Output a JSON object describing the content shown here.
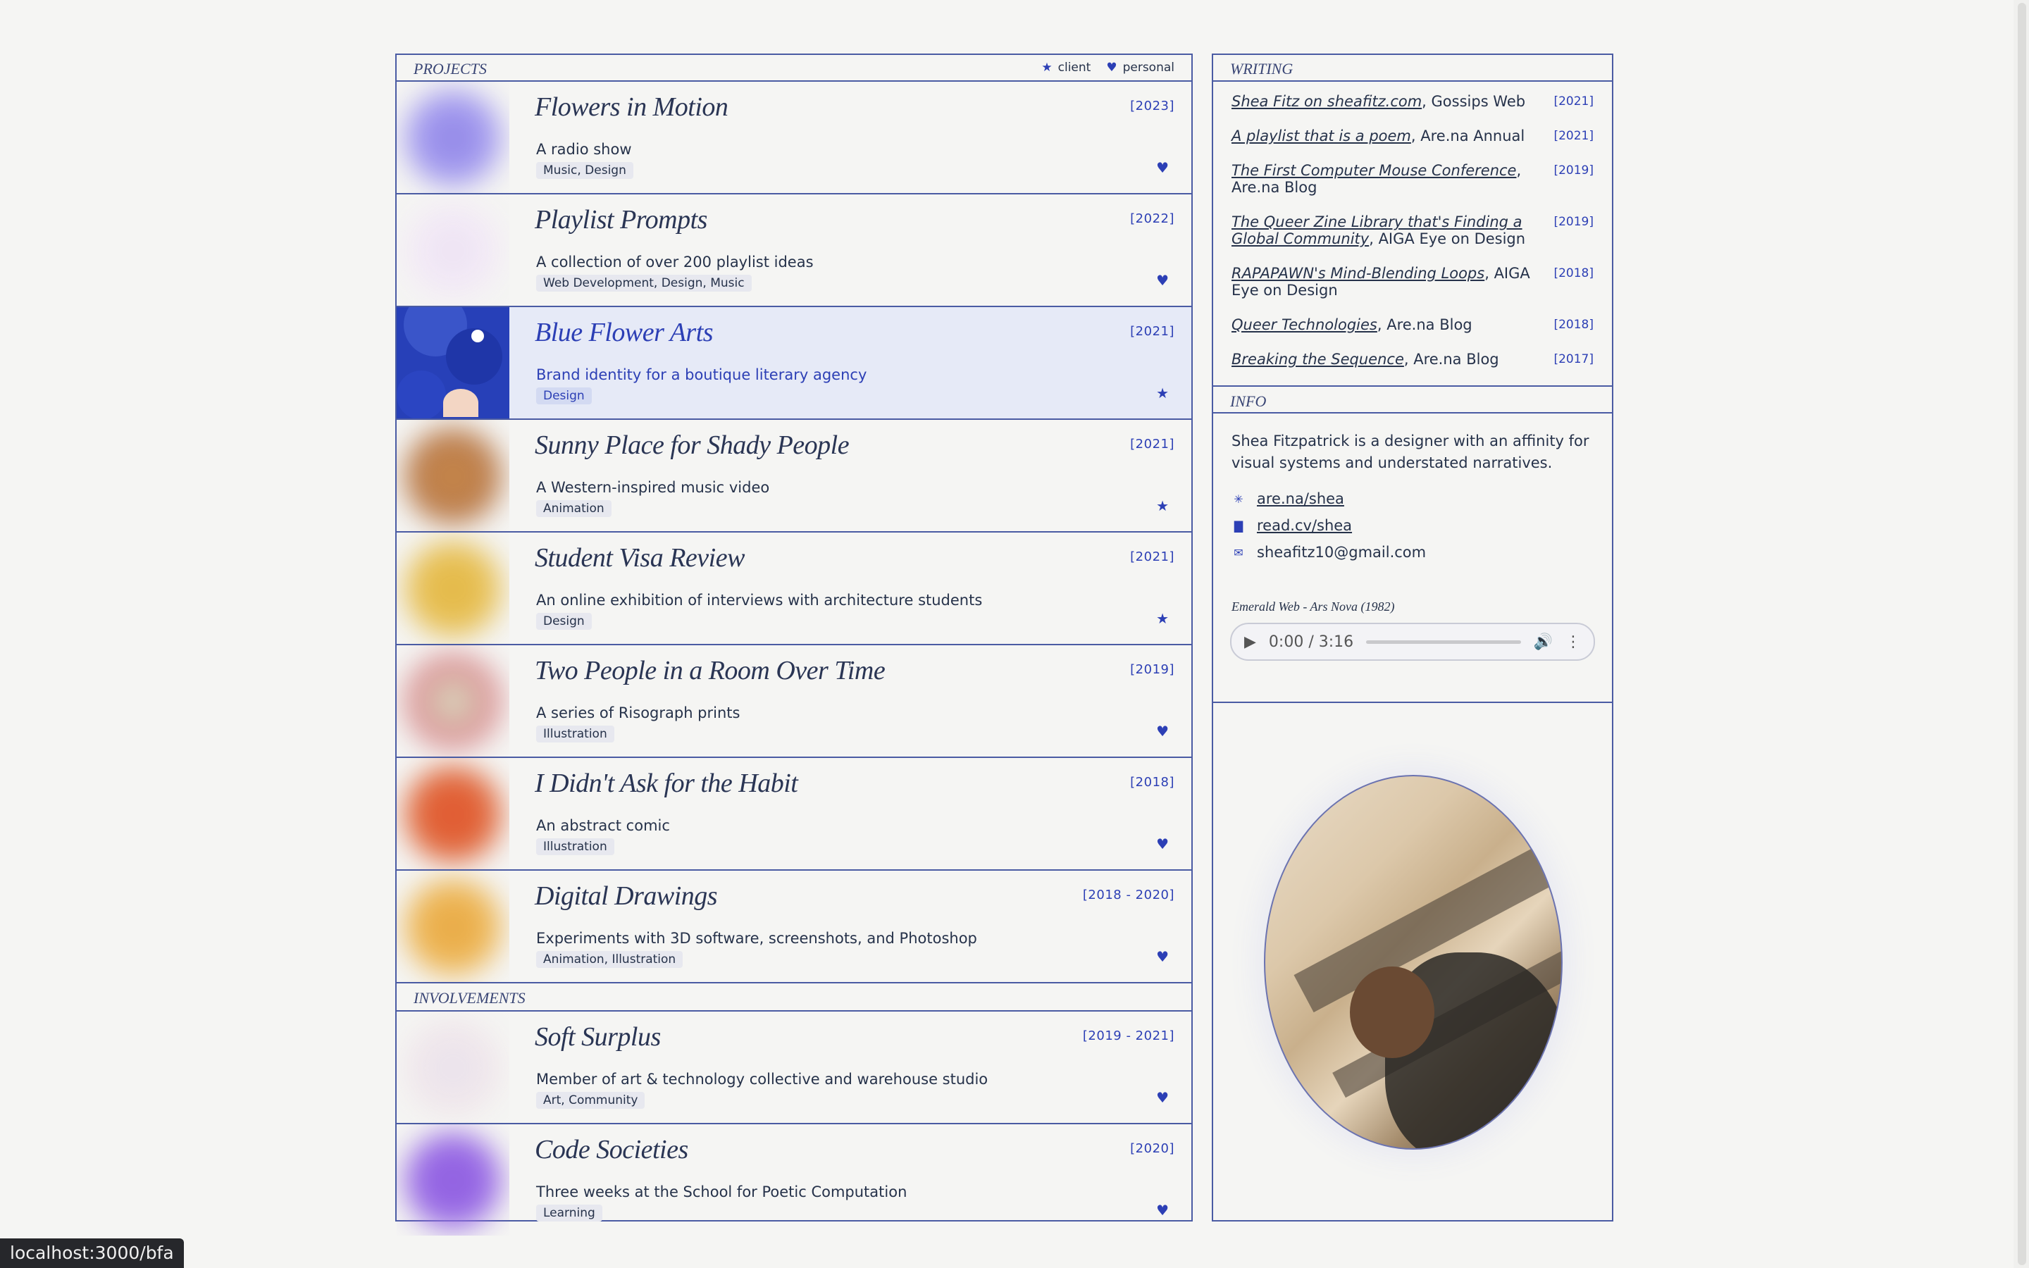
{
  "projects_label": "PROJECTS",
  "legend": {
    "client": "client",
    "personal": "personal"
  },
  "projects": [
    {
      "title": "Flowers in Motion",
      "year": "[2023]",
      "desc": "A radio show",
      "tags": "Music, Design",
      "mark": "♥",
      "colors": [
        "#8f84e6",
        "#a79ff0"
      ]
    },
    {
      "title": "Playlist Prompts",
      "year": "[2022]",
      "desc": "A collection of over 200 playlist ideas",
      "tags": "Web Development, Design, Music",
      "mark": "♥",
      "colors": [
        "#ece2f3",
        "#f3eaf6"
      ]
    },
    {
      "title": "Blue Flower Arts",
      "year": "[2021]",
      "desc": "Brand identity for a boutique literary agency",
      "tags": "Design",
      "mark": "★",
      "colors": [
        "#2740b8",
        "#3a55c9"
      ]
    },
    {
      "title": "Sunny Place for Shady People",
      "year": "[2021]",
      "desc": "A Western-inspired music video",
      "tags": "Animation",
      "mark": "★",
      "colors": [
        "#c98a4a",
        "#b8794a"
      ]
    },
    {
      "title": "Student Visa Review",
      "year": "[2021]",
      "desc": "An online exhibition of interviews with architecture students",
      "tags": "Design",
      "mark": "★",
      "colors": [
        "#e3b744",
        "#e8c25a"
      ]
    },
    {
      "title": "Two People in a Room Over Time",
      "year": "[2019]",
      "desc": "A series of Risograph prints",
      "tags": "Illustration",
      "mark": "♥",
      "colors": [
        "#d9e6c6",
        "#d98a8f"
      ]
    },
    {
      "title": "I Didn't Ask for the Habit",
      "year": "[2018]",
      "desc": "An abstract comic",
      "tags": "Illustration",
      "mark": "♥",
      "colors": [
        "#e2562f",
        "#e06b3e"
      ]
    },
    {
      "title": "Digital Drawings",
      "year": "[2018 - 2020]",
      "desc": "Experiments with 3D software, screenshots, and Photoshop",
      "tags": "Animation, Illustration",
      "mark": "♥",
      "colors": [
        "#e8a742",
        "#eeb95a"
      ]
    }
  ],
  "involvements_label": "INVOLVEMENTS",
  "involvements": [
    {
      "title": "Soft Surplus",
      "year": "[2019 - 2021]",
      "desc": "Member of art & technology collective and warehouse studio",
      "tags": "Art, Community",
      "mark": "♥",
      "colors": [
        "#e9e3ee",
        "#f0e6ea"
      ]
    },
    {
      "title": "Code Societies",
      "year": "[2020]",
      "desc": "Three weeks at the School for Poetic Computation",
      "tags": "Learning",
      "mark": "♥",
      "colors": [
        "#8f5ee0",
        "#9b6ee6"
      ]
    }
  ],
  "writing_label": "WRITING",
  "writing": [
    {
      "link": "Shea Fitz on sheafitz.com",
      "rest": ", Gossips Web",
      "year": "[2021]"
    },
    {
      "link": "A playlist that is a poem",
      "rest": ", Are.na Annual",
      "year": "[2021]"
    },
    {
      "link": "The First Computer Mouse Conference",
      "rest": ", Are.na Blog",
      "year": "[2019]"
    },
    {
      "link": "The Queer Zine Library that's Finding a Global Community",
      "rest": ", AIGA Eye on Design",
      "year": "[2019]"
    },
    {
      "link": "RAPAPAWN's Mind-Blending Loops",
      "rest": ", AIGA Eye on Design",
      "year": "[2018]"
    },
    {
      "link": "Queer Technologies",
      "rest": ", Are.na Blog",
      "year": "[2018]"
    },
    {
      "link": "Breaking the Sequence",
      "rest": ", Are.na Blog",
      "year": "[2017]"
    }
  ],
  "info_label": "INFO",
  "bio": "Shea Fitzpatrick is a designer with an affinity for visual systems and understated narratives.",
  "links": [
    {
      "icon": "✳",
      "text": "are.na/shea",
      "underline": true
    },
    {
      "icon": "▇",
      "text": "read.cv/shea",
      "underline": true
    },
    {
      "icon": "✉",
      "text": "sheafitz10@gmail.com",
      "underline": false
    }
  ],
  "song": "Emerald Web - Ars Nova (1982)",
  "player": {
    "time": "0:00 / 3:16"
  },
  "status_url": "localhost:3000/bfa"
}
